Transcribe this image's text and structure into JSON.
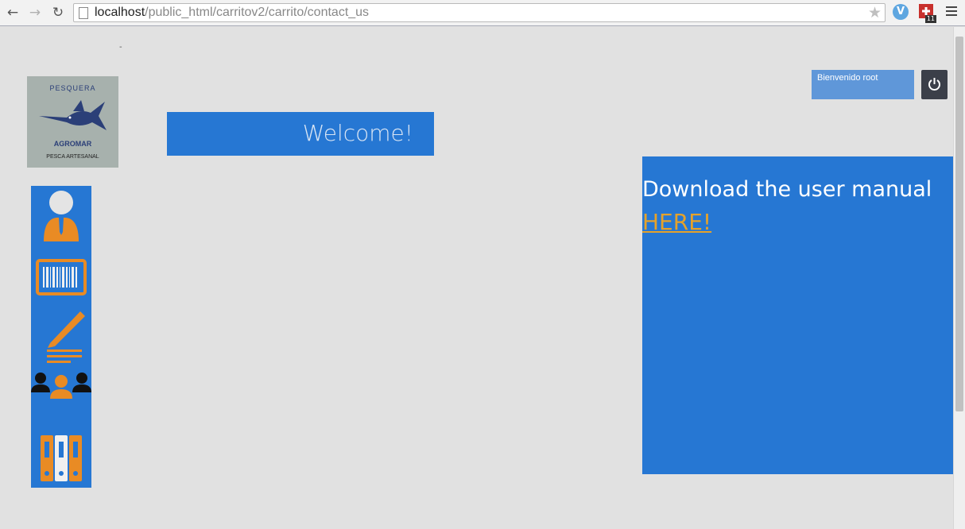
{
  "browser": {
    "url_host": "localhost",
    "url_path": "/public_html/carritov2/carrito/contact_us",
    "extension_badge": "11"
  },
  "page": {
    "dash": "-",
    "logo": {
      "top_text": "PESQUERA",
      "middle_text": "AGROMAR",
      "bottom_text": "PESCA ARTESANAL"
    },
    "welcome": "Welcome!",
    "user_greeting": "Bienvenido root",
    "manual_text": "Download the user manual",
    "manual_link": "HERE!",
    "sidebar_icons": [
      "user-icon",
      "barcode-icon",
      "pen-icon",
      "users-icon",
      "binders-icon"
    ],
    "colors": {
      "primary_blue": "#2677d3",
      "accent_orange": "#e98b24",
      "link_gold": "#e5a22a",
      "background": "#e1e1e1",
      "power_button": "#3b3f49"
    }
  }
}
